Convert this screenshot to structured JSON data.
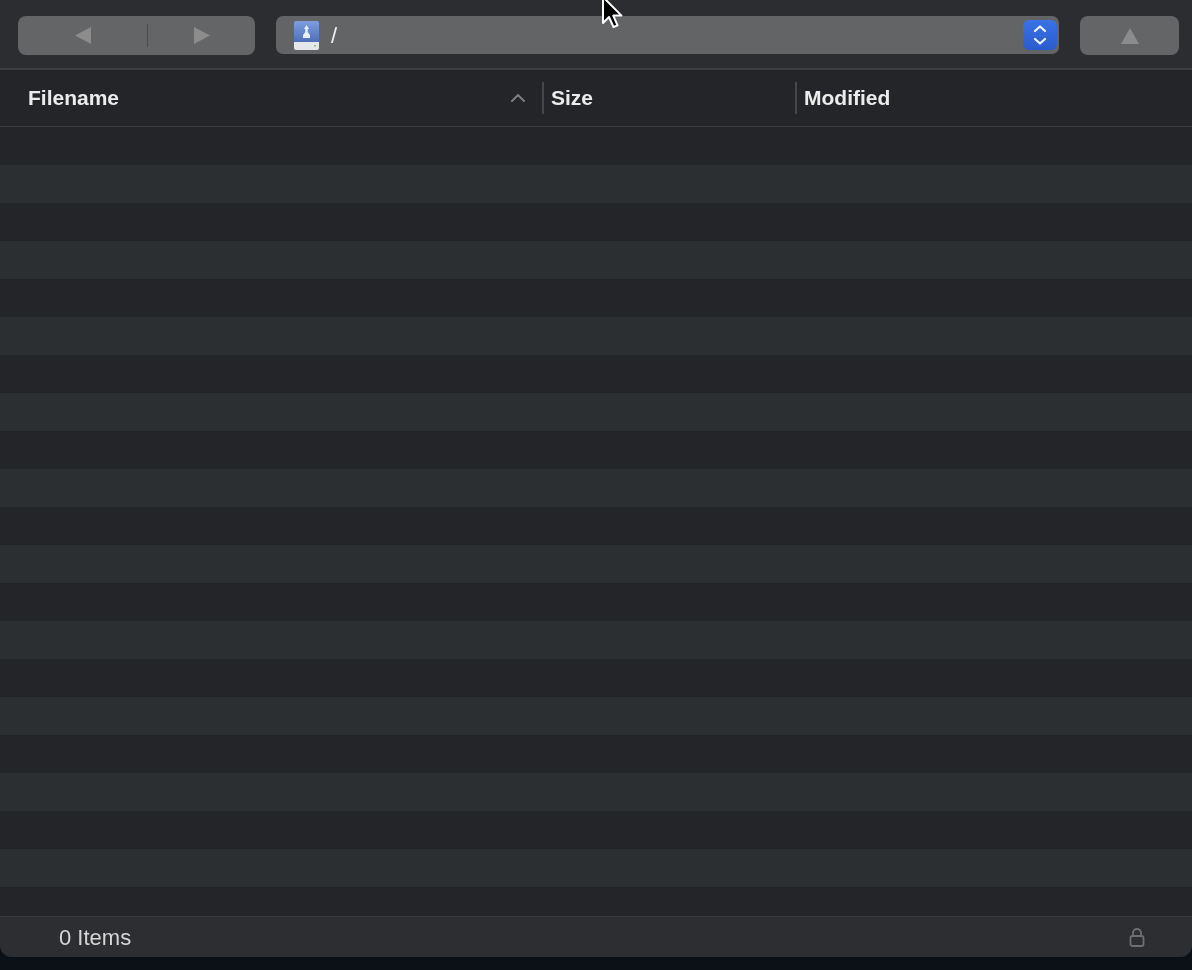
{
  "toolbar": {
    "back_button": {
      "disabled": true
    },
    "forward_button": {
      "disabled": true
    },
    "path_popup": {
      "value": "/"
    },
    "up_button": {
      "disabled": true
    }
  },
  "table": {
    "columns": [
      {
        "label": "Filename",
        "sorted": true,
        "ascending": true
      },
      {
        "label": "Size",
        "sorted": false
      },
      {
        "label": "Modified",
        "sorted": false
      }
    ]
  },
  "status_bar": {
    "item_count": "0 Items"
  }
}
